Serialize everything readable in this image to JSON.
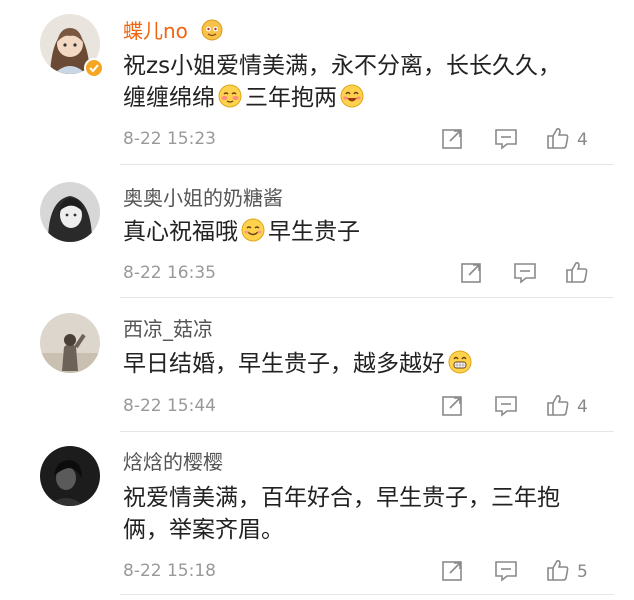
{
  "comments": [
    {
      "name": "蝶儿no",
      "lines": [
        "祝zs小姐爱情美满，永不分离，长长久久，",
        "缠缠绵绵",
        "三年抱两"
      ],
      "time": "8-22 15:23",
      "likes": "4",
      "name_color": "#f0640f",
      "verified": true
    },
    {
      "name": "奥奥小姐的奶糖酱",
      "lines": [
        "真心祝福哦",
        "早生贵子"
      ],
      "time": "8-22 16:35",
      "likes": ""
    },
    {
      "name": "西凉_菇凉",
      "lines": [
        "早日结婚，早生贵子，越多越好"
      ],
      "time": "8-22 15:44",
      "likes": "4"
    },
    {
      "name": "焓焓的樱樱",
      "lines": [
        "祝爱情美满，百年好合，早生贵子，三年抱",
        "俩，举案齐眉。"
      ],
      "time": "8-22 15:18",
      "likes": "5"
    }
  ],
  "icons": {
    "vip": "vip-emoji-icon",
    "share": "share-icon",
    "comment": "comment-icon",
    "like": "thumbs-up-icon",
    "emoji_shy": "shy-face-emoji-icon",
    "emoji_happy": "happy-face-emoji-icon",
    "emoji_smile": "smile-face-emoji-icon",
    "emoji_grin": "grin-face-emoji-icon"
  }
}
